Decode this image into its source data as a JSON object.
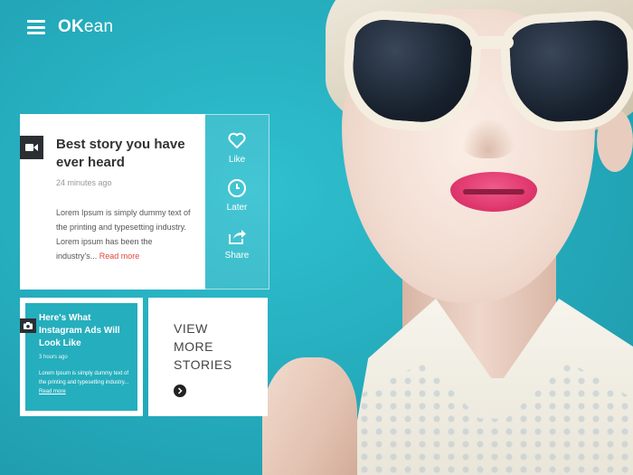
{
  "header": {
    "menu_icon": "hamburger-menu-icon",
    "logo_bold": "OK",
    "logo_rest": "ean"
  },
  "featured_story": {
    "media_icon": "video-camera-icon",
    "title": "Best story you have ever heard",
    "time": "24 minutes ago",
    "excerpt": "Lorem Ipsum is simply dummy text of the printing and typesetting industry. Lorem ipsum has been the industry's... ",
    "read_more": "Read more",
    "actions": [
      {
        "label": "Like",
        "icon": "heart-icon"
      },
      {
        "label": "Later",
        "icon": "clock-icon"
      },
      {
        "label": "Share",
        "icon": "share-icon"
      }
    ]
  },
  "small_story": {
    "media_icon": "camera-icon",
    "title": "Here's What Instagram Ads Will Look Like",
    "time": "3 hours ago",
    "excerpt": "Lorem Ipsum is simply dummy text of the printing and typesetting industry... ",
    "read_more": "Read more"
  },
  "view_more": {
    "label": "VIEW\nMORE\nSTORIES",
    "arrow_icon": "arrow-right-circle-icon"
  },
  "colors": {
    "accent": "#25aebd",
    "link": "#e0463c",
    "badge": "#2b2f33"
  }
}
